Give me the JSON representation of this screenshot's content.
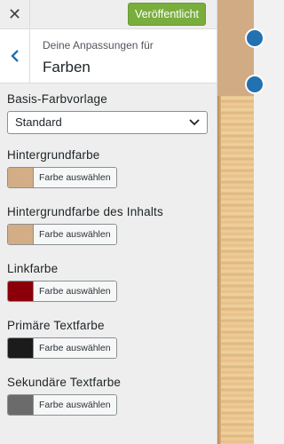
{
  "topbar": {
    "close_label": "✕",
    "publish_label": "Veröffentlicht"
  },
  "header": {
    "subtitle": "Deine Anpassungen für",
    "title": "Farben"
  },
  "scheme": {
    "label": "Basis-Farbvorlage",
    "selected": "Standard"
  },
  "color_button_label": "Farbe auswählen",
  "colors": [
    {
      "label": "Hintergrundfarbe",
      "swatch": "#d2ad86"
    },
    {
      "label": "Hintergrundfarbe des Inhalts",
      "swatch": "#d2ad86"
    },
    {
      "label": "Linkfarbe",
      "swatch": "#8b0008"
    },
    {
      "label": "Primäre Textfarbe",
      "swatch": "#1b1b1b"
    },
    {
      "label": "Sekundäre Textfarbe",
      "swatch": "#6b6b6b"
    }
  ],
  "icons": {
    "close": "close-icon",
    "back": "chevron-left-icon",
    "dropdown": "chevron-down-icon",
    "edit": "edit-shortcut-icon"
  },
  "accent_color": "#79ae3d"
}
